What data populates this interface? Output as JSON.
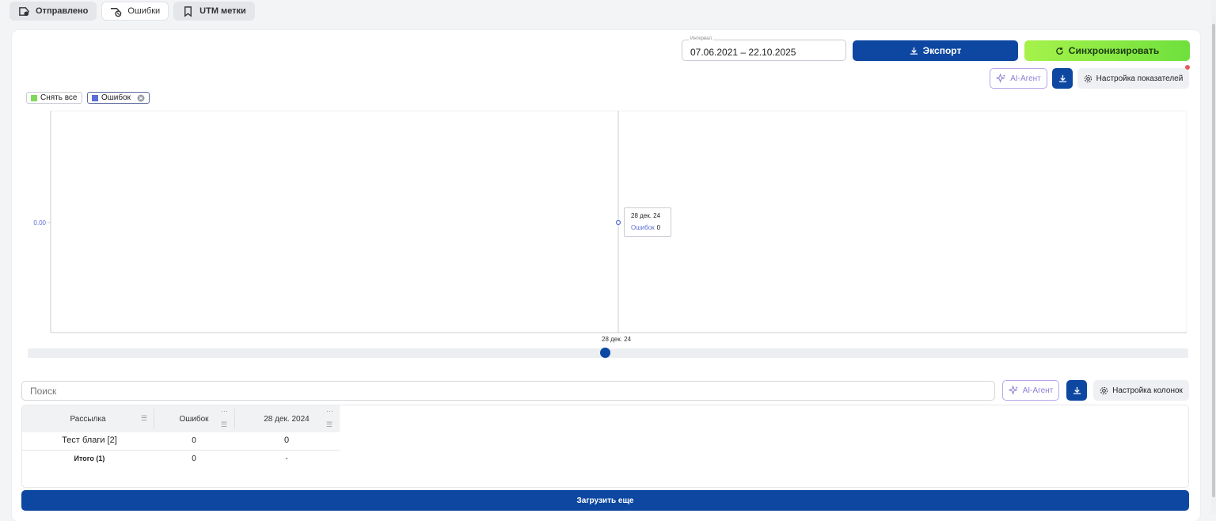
{
  "tabs": [
    {
      "label": "Отправлено",
      "icon": "send-icon"
    },
    {
      "label": "Ошибки",
      "icon": "error-send-icon"
    },
    {
      "label": "UTM метки",
      "icon": "bookmark-icon"
    }
  ],
  "active_tab": "Ошибки",
  "toolbar": {
    "interval_label": "Интервал",
    "interval_value": "07.06.2021 – 22.10.2025",
    "export_label": "Экспорт",
    "sync_label": "Синхронизировать",
    "ai_agent_label": "AI-Агент",
    "settings_label": "Настройка показателей"
  },
  "chart_legend": {
    "deselect_all": "Снять все",
    "series_chip": "Ошибок",
    "deselect_color": "#7ed957",
    "series_color": "#5a6fd8"
  },
  "chart_data": {
    "type": "line",
    "x": [
      "28 дек. 24"
    ],
    "series": [
      {
        "name": "Ошибок",
        "values": [
          0
        ]
      }
    ],
    "title": "",
    "xlabel": "",
    "ylabel": "",
    "y_ticks": [
      "0.00"
    ],
    "grid": false,
    "tooltip": {
      "date": "28 дек. 24",
      "series": "Ошибок",
      "value": "0"
    }
  },
  "table_toolbar": {
    "search_placeholder": "Поиск",
    "ai_agent_label": "AI-Агент",
    "columns_settings_label": "Настройка колонок"
  },
  "table": {
    "columns": [
      "Рассылка",
      "Ошибок",
      "28 дек. 2024"
    ],
    "rows": [
      [
        "Тест благи [2]",
        "0",
        "0"
      ]
    ],
    "total": [
      "Итого (1)",
      "0",
      "-"
    ]
  },
  "load_more_label": "Загрузить еще",
  "colors": {
    "primary": "#0d47a1",
    "sync_gradient_start": "#a6f24b",
    "sync_gradient_end": "#6fe03d",
    "ai_border": "#b9a7e8",
    "notification": "#e35d5d"
  }
}
